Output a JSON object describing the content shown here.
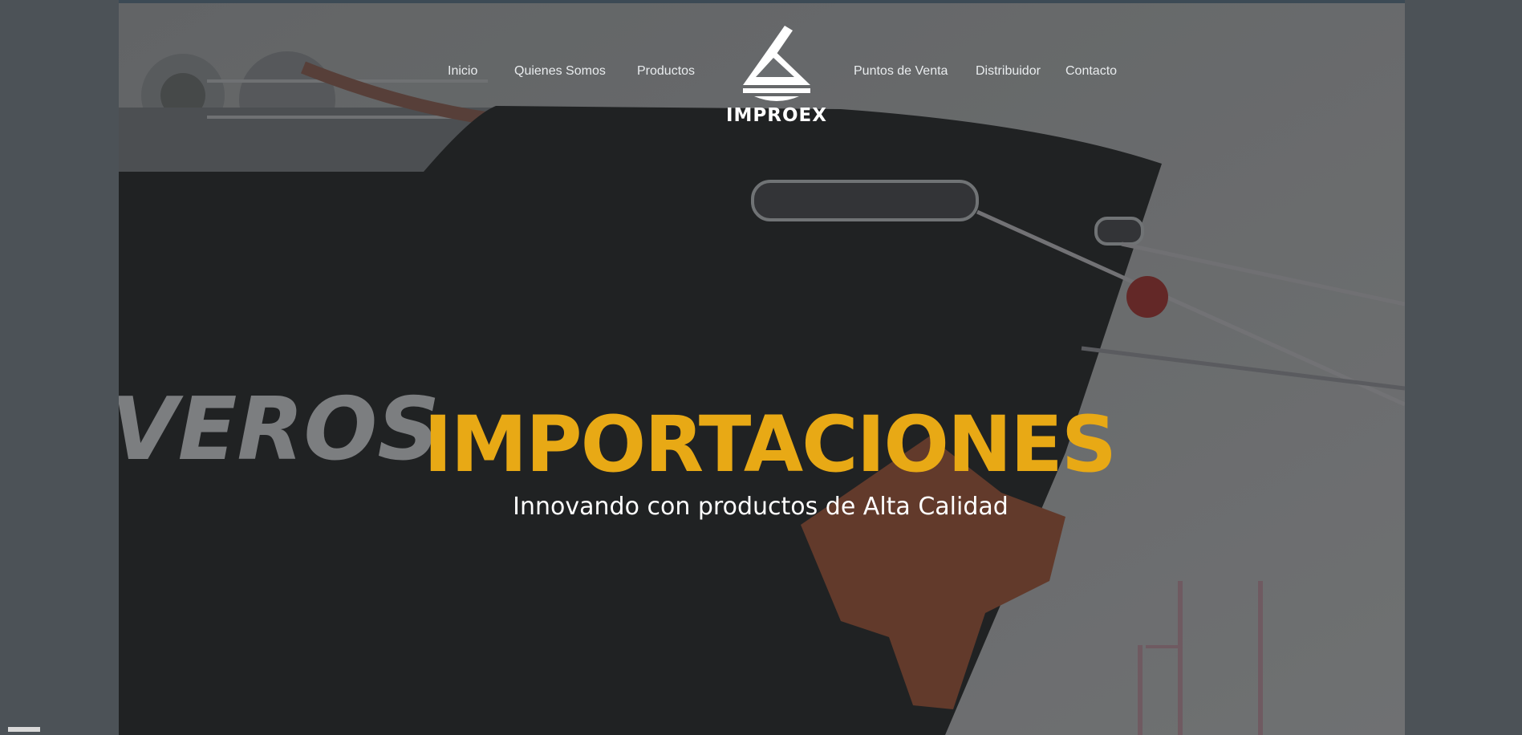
{
  "brand": {
    "name": "IMPROEX"
  },
  "nav": {
    "left": [
      "Inicio",
      "Quienes Somos",
      "Productos"
    ],
    "right": [
      "Puntos de Venta",
      "Distribuidor",
      "Contacto"
    ]
  },
  "hero": {
    "title": "IMPORTACIONES",
    "subtitle": "Innovando con productos de Alta Calidad",
    "ship_hull_text": "VEROS"
  },
  "colors": {
    "accent": "#e8a915",
    "overlay": "#2b2b2b",
    "background": "#4d5358"
  }
}
